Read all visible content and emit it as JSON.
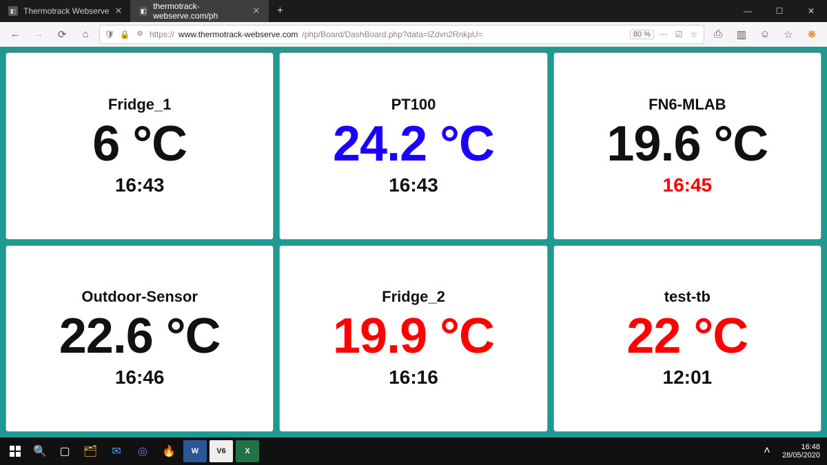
{
  "titlebar": {
    "tabs": [
      {
        "label": "Thermotrack Webserve"
      },
      {
        "label": "thermotrack-webserve.com/ph"
      }
    ],
    "plus": "+"
  },
  "toolbar": {
    "url_proto": "https://",
    "url_host": "www.thermotrack-webserve.com",
    "url_path": "/php/Board/DashBoard.php?data=lZdvn2RnkpU=",
    "zoom": "80 %"
  },
  "dashboard": {
    "cards": [
      {
        "name": "Fridge_1",
        "value": "6 °C",
        "time": "16:43",
        "valueColor": "c-black",
        "timeColor": "c-black"
      },
      {
        "name": "PT100",
        "value": "24.2 °C",
        "time": "16:43",
        "valueColor": "c-blue",
        "timeColor": "c-black"
      },
      {
        "name": "FN6-MLAB",
        "value": "19.6 °C",
        "time": "16:45",
        "valueColor": "c-black",
        "timeColor": "c-red"
      },
      {
        "name": "Outdoor-Sensor",
        "value": "22.6 °C",
        "time": "16:46",
        "valueColor": "c-black",
        "timeColor": "c-black"
      },
      {
        "name": "Fridge_2",
        "value": "19.9 °C",
        "time": "16:16",
        "valueColor": "c-red",
        "timeColor": "c-black"
      },
      {
        "name": "test-tb",
        "value": "22 °C",
        "time": "12:01",
        "valueColor": "c-red",
        "timeColor": "c-black"
      }
    ]
  },
  "taskbar": {
    "time": "16:48",
    "date": "28/05/2020"
  }
}
